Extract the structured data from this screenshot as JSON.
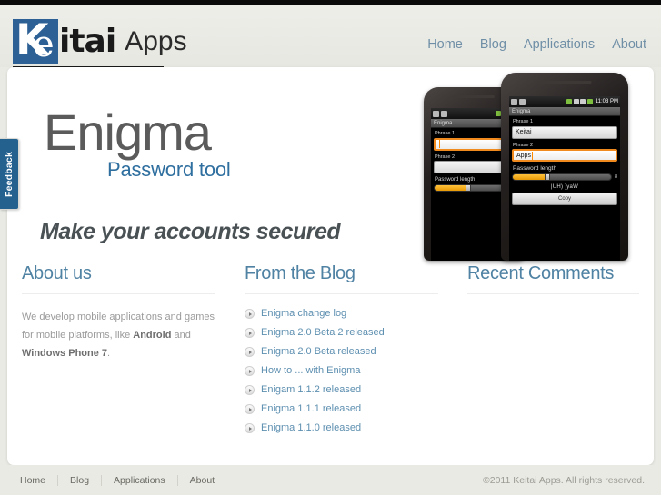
{
  "site": {
    "logo_k": "K",
    "logo_e": "e",
    "logo_itai": "itai",
    "logo_apps": "Apps"
  },
  "header": {
    "nav": [
      {
        "label": "Home"
      },
      {
        "label": "Blog"
      },
      {
        "label": "Applications"
      },
      {
        "label": "About"
      }
    ]
  },
  "feedback_tab": {
    "label": "Feedback",
    "color": "#24618f"
  },
  "hero": {
    "title": "Enigma",
    "subtitle": "Password tool",
    "tagline": "Make your accounts secured",
    "subtitle_color": "#2f6f9f"
  },
  "phone_back": {
    "clock": "",
    "app_title": "Enigma",
    "phrase1_label": "Phrase 1",
    "phrase1_value": "",
    "phrase2_label": "Phrase 2",
    "phrase2_value": "",
    "length_label": "Password length",
    "length_value": ""
  },
  "phone_front": {
    "clock": "11:03 PM",
    "app_title": "Enigma",
    "phrase1_label": "Phrase 1",
    "phrase1_value": "Keitai",
    "phrase2_label": "Phrase 2",
    "phrase2_value": "Apps",
    "length_label": "Password length",
    "length_value": "8",
    "result": "|UH) ]yaW",
    "copy_label": "Copy"
  },
  "columns": {
    "about": {
      "heading": "About us",
      "text_part1": "We develop mobile applications and games for mobile platforms, like ",
      "bold1": "Android",
      "text_part2": " and ",
      "bold2": "Windows Phone 7",
      "text_part3": "."
    },
    "blog": {
      "heading": "From the Blog",
      "items": [
        {
          "label": "Enigma change log"
        },
        {
          "label": "Enigma 2.0 Beta 2 released"
        },
        {
          "label": "Enigma 2.0 Beta released"
        },
        {
          "label": "How to ... with Enigma"
        },
        {
          "label": "Enigam 1.1.2 released"
        },
        {
          "label": "Enigma 1.1.1 released"
        },
        {
          "label": "Enigma 1.1.0 released"
        }
      ]
    },
    "comments": {
      "heading": "Recent Comments",
      "items": []
    }
  },
  "footer": {
    "nav": [
      {
        "label": "Home"
      },
      {
        "label": "Blog"
      },
      {
        "label": "Applications"
      },
      {
        "label": "About"
      }
    ],
    "copyright": "©2011 Keitai Apps. All rights reserved."
  }
}
